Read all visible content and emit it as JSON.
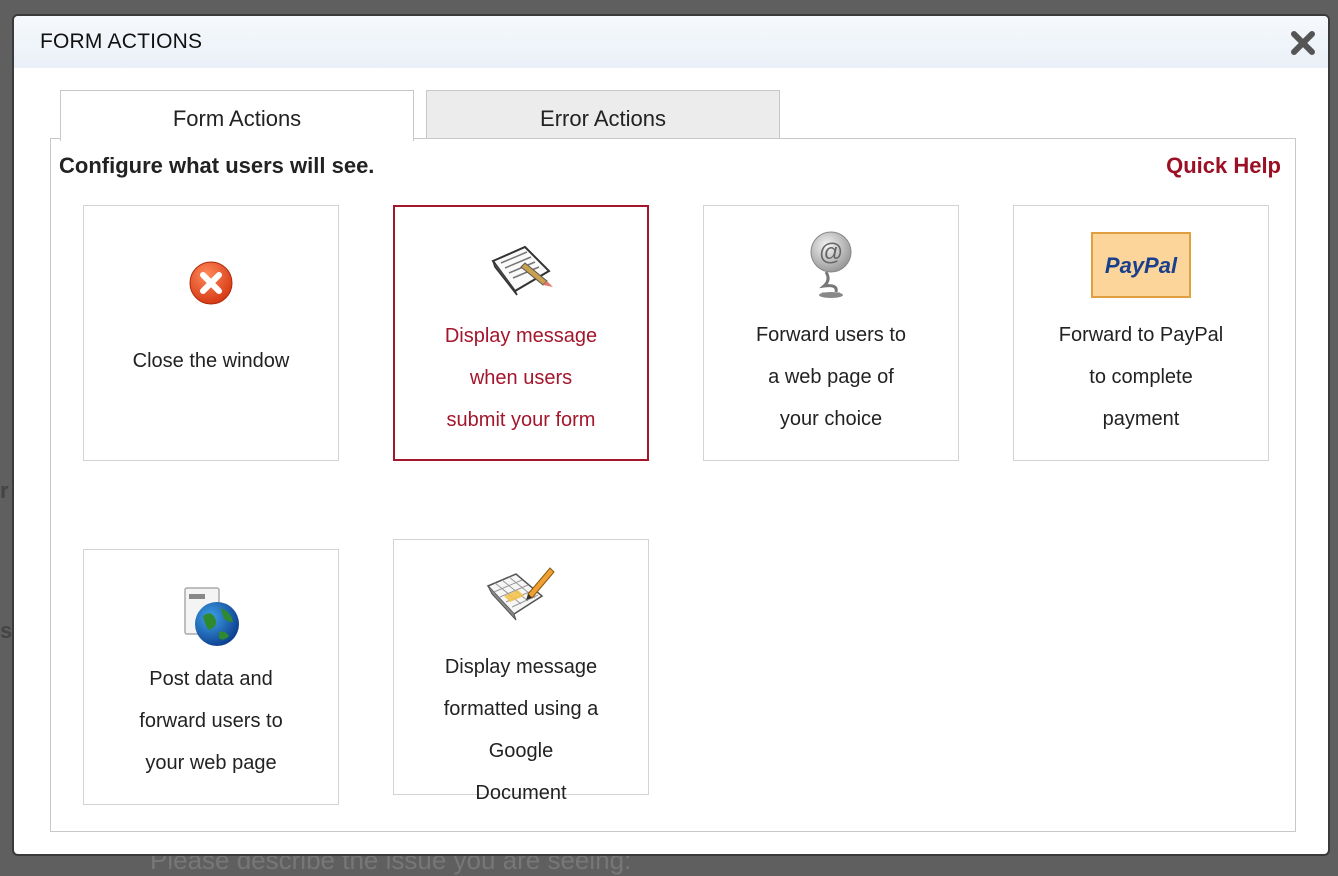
{
  "dialog": {
    "title": "FORM ACTIONS"
  },
  "tabs": [
    {
      "label": "Form Actions",
      "active": true
    },
    {
      "label": "Error Actions",
      "active": false
    }
  ],
  "panel": {
    "heading": "Configure what users will see.",
    "quick_help": "Quick Help"
  },
  "cards": [
    {
      "icon": "close-circle-icon",
      "lines": [
        "Close the window"
      ],
      "selected": false
    },
    {
      "icon": "notepad-pencil-icon",
      "lines": [
        "Display message",
        "when users",
        "submit your form"
      ],
      "selected": true
    },
    {
      "icon": "email-at-icon",
      "lines": [
        "Forward users to",
        "a web page of",
        "your choice"
      ],
      "selected": false
    },
    {
      "icon": "paypal-icon",
      "icon_text": "PayPal",
      "lines": [
        "Forward to PayPal",
        "to complete",
        "payment"
      ],
      "selected": false
    },
    {
      "icon": "globe-document-icon",
      "lines": [
        "Post data and",
        "forward users to",
        "your web page"
      ],
      "selected": false
    },
    {
      "icon": "spreadsheet-pencil-icon",
      "lines": [
        "Display message",
        "formatted using a",
        "Google",
        "Document"
      ],
      "selected": false
    }
  ],
  "background": {
    "text": "Please describe the issue you are seeing:"
  },
  "colors": {
    "accent": "#a4162c",
    "quick_help": "#9b1025",
    "header_bg": "#eef3f8"
  }
}
